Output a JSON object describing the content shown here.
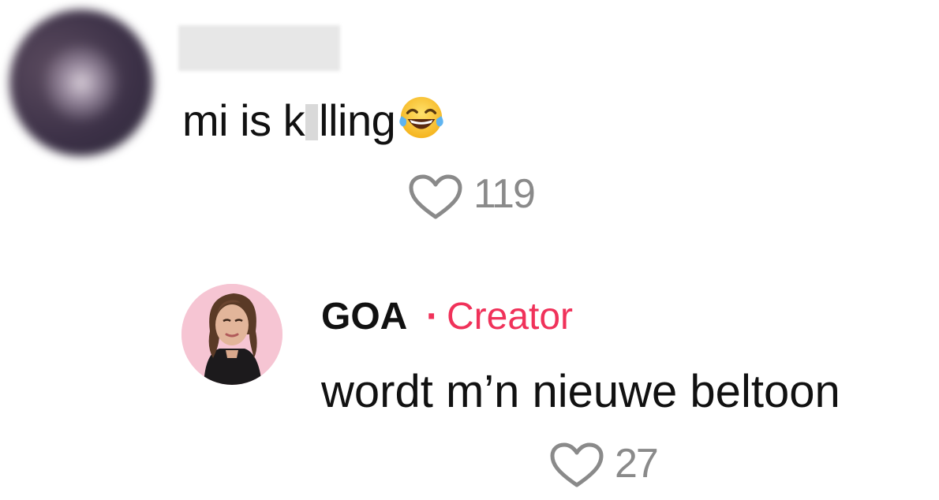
{
  "comments": [
    {
      "avatar": "blurred-user-avatar",
      "username": "",
      "text_before": "mi is k",
      "text_after": "lling",
      "emoji": "face-with-tears-of-joy",
      "likes": "119"
    },
    {
      "avatar": "creator-avatar",
      "username": "GOA",
      "badge_separator": "·",
      "badge": "Creator",
      "text": "wordt m’n nieuwe beltoon",
      "likes": "27"
    }
  ],
  "colors": {
    "creator_badge": "#f0325a",
    "like_icon": "#8a8a8a",
    "text": "#111111"
  }
}
